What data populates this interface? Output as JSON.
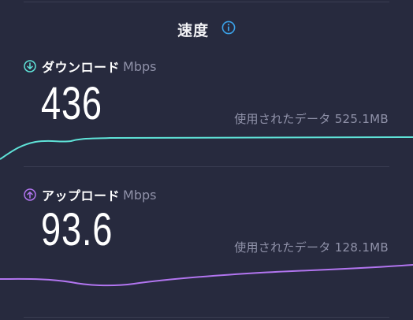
{
  "header": {
    "title": "速度",
    "info_icon": "info-circle-icon",
    "info_color": "#3aa0e6"
  },
  "download": {
    "icon": "arrow-down-circle-icon",
    "label": "ダウンロード",
    "unit": "Mbps",
    "value": "436",
    "data_used_label": "使用されたデータ",
    "data_used_value": "525.1MB",
    "color": "#5fe3d8"
  },
  "upload": {
    "icon": "arrow-up-circle-icon",
    "label": "アップロード",
    "unit": "Mbps",
    "value": "93.6",
    "data_used_label": "使用されたデータ",
    "data_used_value": "128.1MB",
    "color": "#b275f0"
  }
}
